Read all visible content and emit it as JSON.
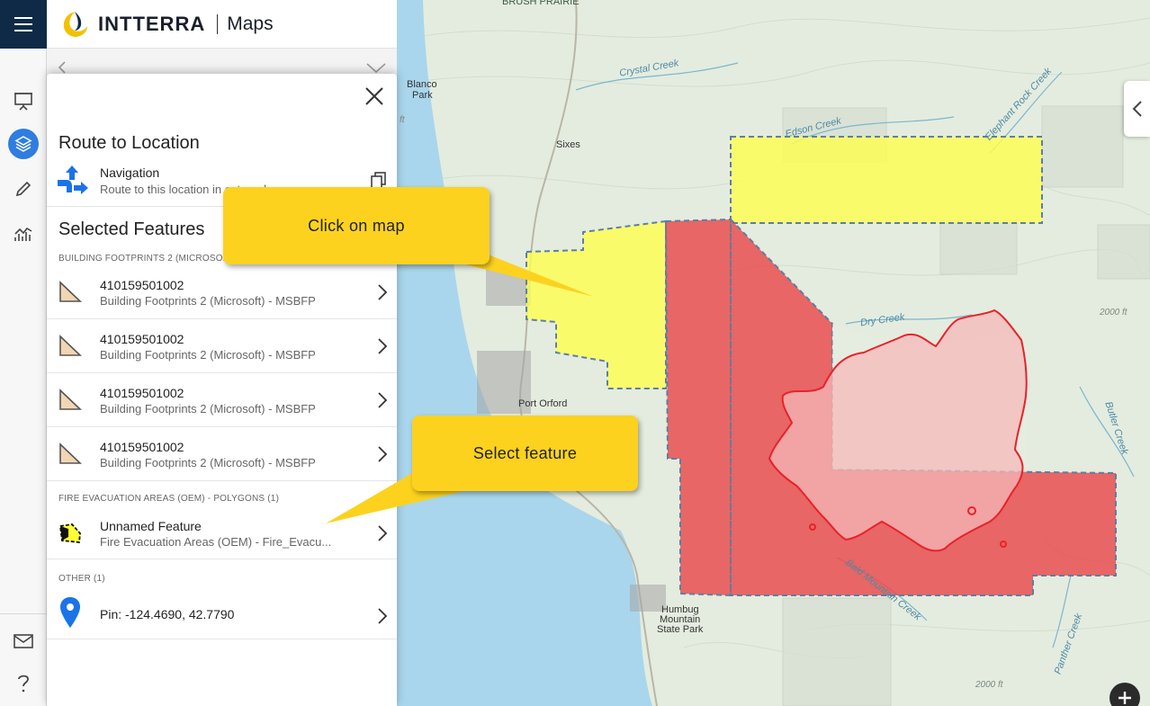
{
  "brand": {
    "wordmark": "INTTERRA",
    "app_name": "Maps"
  },
  "panel": {
    "route_title": "Route to Location",
    "navigation": {
      "title": "Navigation",
      "subtitle": "Route to this location in external map"
    },
    "selected_title": "Selected Features",
    "group_buildings": "BUILDING FOOTPRINTS 2 (MICROSOFT) - MSBFP (4)",
    "buildings": [
      {
        "id": "410159501002",
        "source": "Building Footprints 2 (Microsoft) - MSBFP"
      },
      {
        "id": "410159501002",
        "source": "Building Footprints 2 (Microsoft) - MSBFP"
      },
      {
        "id": "410159501002",
        "source": "Building Footprints 2 (Microsoft) - MSBFP"
      },
      {
        "id": "410159501002",
        "source": "Building Footprints 2 (Microsoft) - MSBFP"
      }
    ],
    "group_evac": "FIRE EVACUATION AREAS (OEM) - POLYGONS (1)",
    "evac": {
      "title": "Unnamed Feature",
      "source": "Fire Evacuation Areas (OEM) - Fire_Evacu..."
    },
    "group_other": "OTHER (1)",
    "pin": {
      "label": "Pin: -124.4690, 42.7790"
    }
  },
  "callouts": {
    "click_map": "Click on map",
    "select_feature": "Select feature"
  },
  "map_labels": {
    "brush_prairie": "BRUSH PRAIRIE",
    "crystal_creek": "Crystal Creek",
    "edson_creek": "Edson Creek",
    "elephant_rock_creek": "Elephant Rock Creek",
    "blanco": "Blanco",
    "park": "Park",
    "sixes": "Sixes",
    "dry_creek": "Dry Creek",
    "port_orford": "Port Orford",
    "butler_creek": "Butler Creek",
    "bald_mountain_creek": "Bald Mountain Creek",
    "humbug": "Humbug",
    "mountain": "Mountain",
    "state_park": "State Park",
    "panther_creek": "Panther Creek",
    "elev_2000_a": "2000 ft",
    "elev_2000_b": "2000 ft",
    "elev_ft": "ft"
  },
  "colors": {
    "rail_active": "#2f7de1",
    "header_dark": "#0e2a47",
    "callout": "#fcd21f",
    "evac_yellow": "#ffff4d",
    "evac_red": "#e9484a",
    "fire_perimeter": "#e8222a",
    "ocean": "#a9d6ec",
    "pin_blue": "#1a73e8"
  }
}
